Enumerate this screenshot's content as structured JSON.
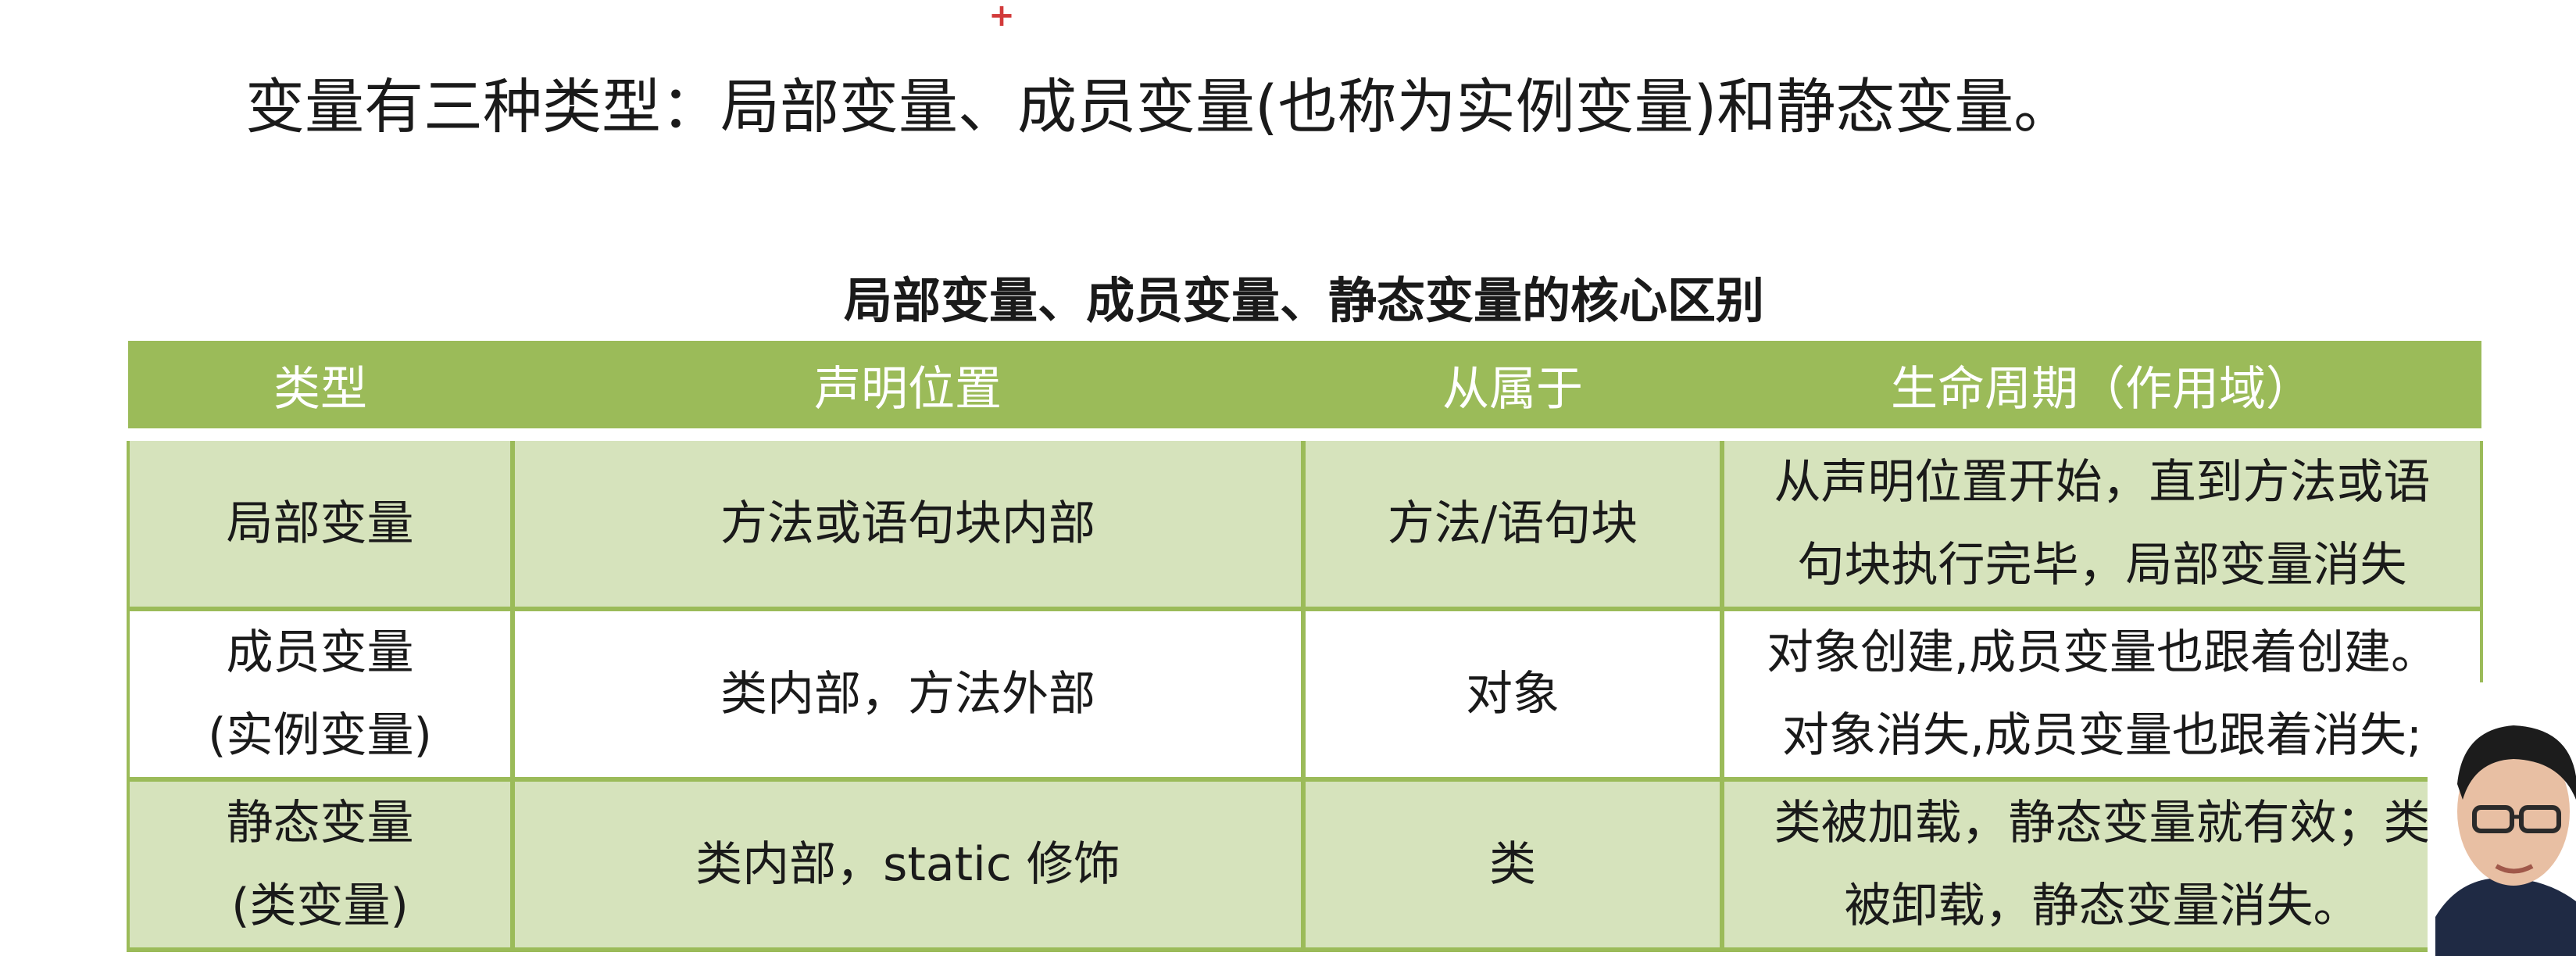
{
  "intro_text": "变量有三种类型：局部变量、成员变量(也称为实例变量)和静态变量。",
  "table_title": "局部变量、成员变量、静态变量的核心区别",
  "table": {
    "headers": [
      "类型",
      "声明位置",
      "从属于",
      "生命周期（作用域）"
    ],
    "rows": [
      {
        "type": [
          "局部变量"
        ],
        "location": "方法或语句块内部",
        "belongs_to": "方法/语句块",
        "lifecycle": [
          "从声明位置开始，直到方法或语",
          "句块执行完毕，局部变量消失"
        ]
      },
      {
        "type": [
          "成员变量",
          "(实例变量)"
        ],
        "location": "类内部，方法外部",
        "belongs_to": "对象",
        "lifecycle": [
          "对象创建,成员变量也跟着创建。",
          "对象消失,成员变量也跟着消失;"
        ]
      },
      {
        "type": [
          "静态变量",
          "(类变量)"
        ],
        "location": "类内部，static 修饰",
        "belongs_to": "类",
        "lifecycle": [
          "类被加载，静态变量就有效；类",
          "被卸载，静态变量消失。"
        ]
      }
    ]
  },
  "colors": {
    "header_bg": "#9bbb59",
    "row_shade": "#d6e3bc",
    "border": "#9bbb59",
    "cursor": "#d23a3a"
  },
  "cursor_glyph": "+"
}
